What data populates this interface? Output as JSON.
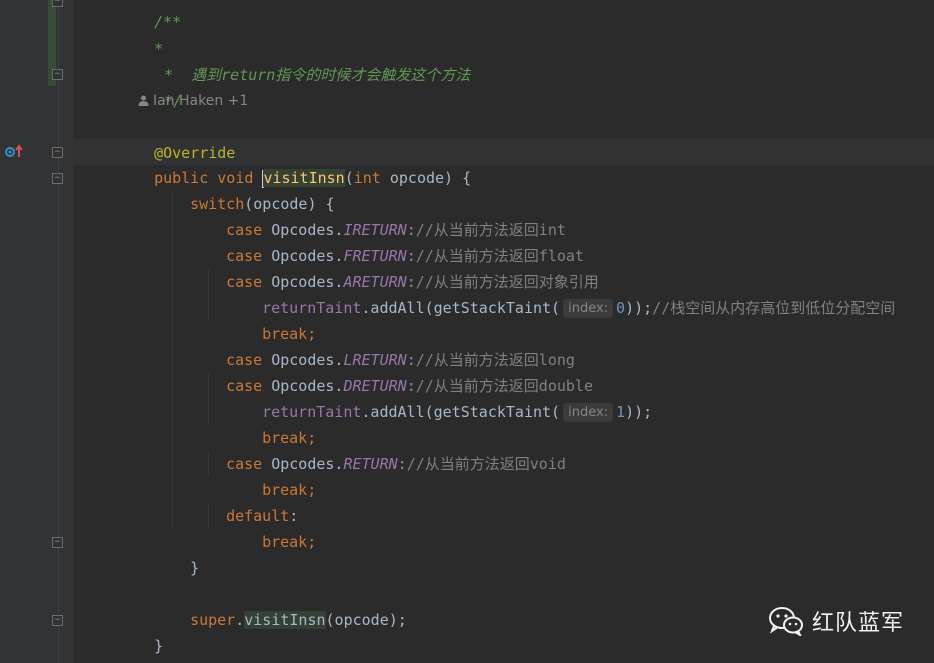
{
  "editor": {
    "lines": {
      "comment_star": "*",
      "comment_text": "*  遇到return指令的时候才会触发这个方法",
      "comment_end": "*/",
      "author": "Ian Haken +1",
      "annotation": "@Override",
      "public_kw": "public",
      "void_kw": "void",
      "method_name": "visitInsn",
      "open_paren": "(",
      "int_kw": "int",
      "param_tail": " opcode) {",
      "switch_kw": "switch",
      "switch_tail": "(opcode) {",
      "case_kw": "case",
      "opcodes_prefix": "Opcodes.",
      "ireturn": "IRETURN",
      "ireturn_comment": "://从当前方法返回int",
      "freturn": "FRETURN",
      "freturn_comment": "://从当前方法返回float",
      "areturn": "ARETURN",
      "areturn_comment": "://从当前方法返回对象引用",
      "return_taint": "returnTaint",
      "add_all": ".addAll(getStackTaint(",
      "index_hint": "index:",
      "index_0": "0",
      "close_paren_semi_0": "));",
      "stack_comment": "//栈空间从内存高位到低位分配空间",
      "break_kw": "break;",
      "lreturn": "LRETURN",
      "lreturn_comment": "://从当前方法返回long",
      "dreturn": "DRETURN",
      "dreturn_comment": "://从当前方法返回double",
      "index_1": "1",
      "close_paren_semi_1": "));",
      "return_const": "RETURN",
      "return_comment": "://从当前方法返回void",
      "default_kw": "default",
      "colon": ":",
      "close_brace": "}",
      "super_kw": "super",
      "super_call": "visitInsn",
      "super_tail": "(opcode);",
      "method_close": "}"
    }
  },
  "watermark": {
    "text": "红队蓝军",
    "icon": "wechat-icon"
  },
  "colors": {
    "background": "#2b2b2b",
    "keyword": "#cc7832",
    "comment": "#629755",
    "annotation": "#bbb529",
    "method": "#ffc66d",
    "field": "#9876aa",
    "number": "#6897bb",
    "text": "#a9b7c6"
  }
}
